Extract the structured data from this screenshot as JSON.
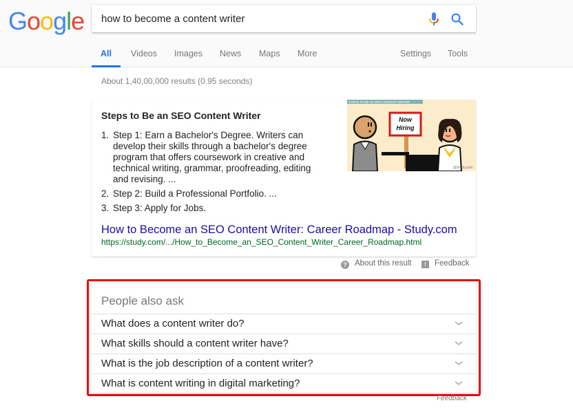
{
  "header": {
    "logo_letters": [
      {
        "char": "G",
        "color": "#4285f4"
      },
      {
        "char": "o",
        "color": "#ea4335"
      },
      {
        "char": "o",
        "color": "#fbbc05"
      },
      {
        "char": "g",
        "color": "#4285f4"
      },
      {
        "char": "l",
        "color": "#34a853"
      },
      {
        "char": "e",
        "color": "#ea4335"
      }
    ],
    "search_value": "how to become a content writer",
    "mic_icon": "microphone-icon",
    "search_icon": "search-icon"
  },
  "tabs": [
    {
      "label": "All",
      "active": true
    },
    {
      "label": "Videos",
      "active": false
    },
    {
      "label": "Images",
      "active": false
    },
    {
      "label": "News",
      "active": false
    },
    {
      "label": "Maps",
      "active": false
    },
    {
      "label": "More",
      "active": false
    },
    {
      "label": "Settings",
      "active": false
    },
    {
      "label": "Tools",
      "active": false
    }
  ],
  "result_stats": "About 1,40,00,000 results (0.95 seconds)",
  "featured_snippet": {
    "title": "Steps to Be an SEO Content Writer",
    "steps": [
      {
        "num": "1.",
        "text": "Step 1: Earn a Bachelor's Degree. Writers can develop their skills through a bachelor's degree program that offers coursework in creative and technical writing, grammar, proofreading, editing and revising. ..."
      },
      {
        "num": "2.",
        "text": "Step 2: Build a Professional Portfolio. ..."
      },
      {
        "num": "3.",
        "text": "Step 3: Apply for Jobs."
      }
    ],
    "image": {
      "banner": "STEPS TO BE AN SEO CONTENT WRITER",
      "sign_line1": "Now",
      "sign_line2": "Hiring",
      "watermark": "@Study.com"
    },
    "link_title": "How to Become an SEO Content Writer: Career Roadmap - Study.com",
    "url": "https://study.com/.../How_to_Become_an_SEO_Content_Writer_Career_Roadmap.html",
    "about_label": "About this result",
    "feedback_label": "Feedback"
  },
  "people_also_ask": {
    "title": "People also ask",
    "questions": [
      "What does a content writer do?",
      "What skills should a content writer have?",
      "What is the job description of a content writer?",
      "What is content writing in digital marketing?"
    ],
    "feedback_label": "Feedback",
    "highlight_color": "#e8070f"
  }
}
